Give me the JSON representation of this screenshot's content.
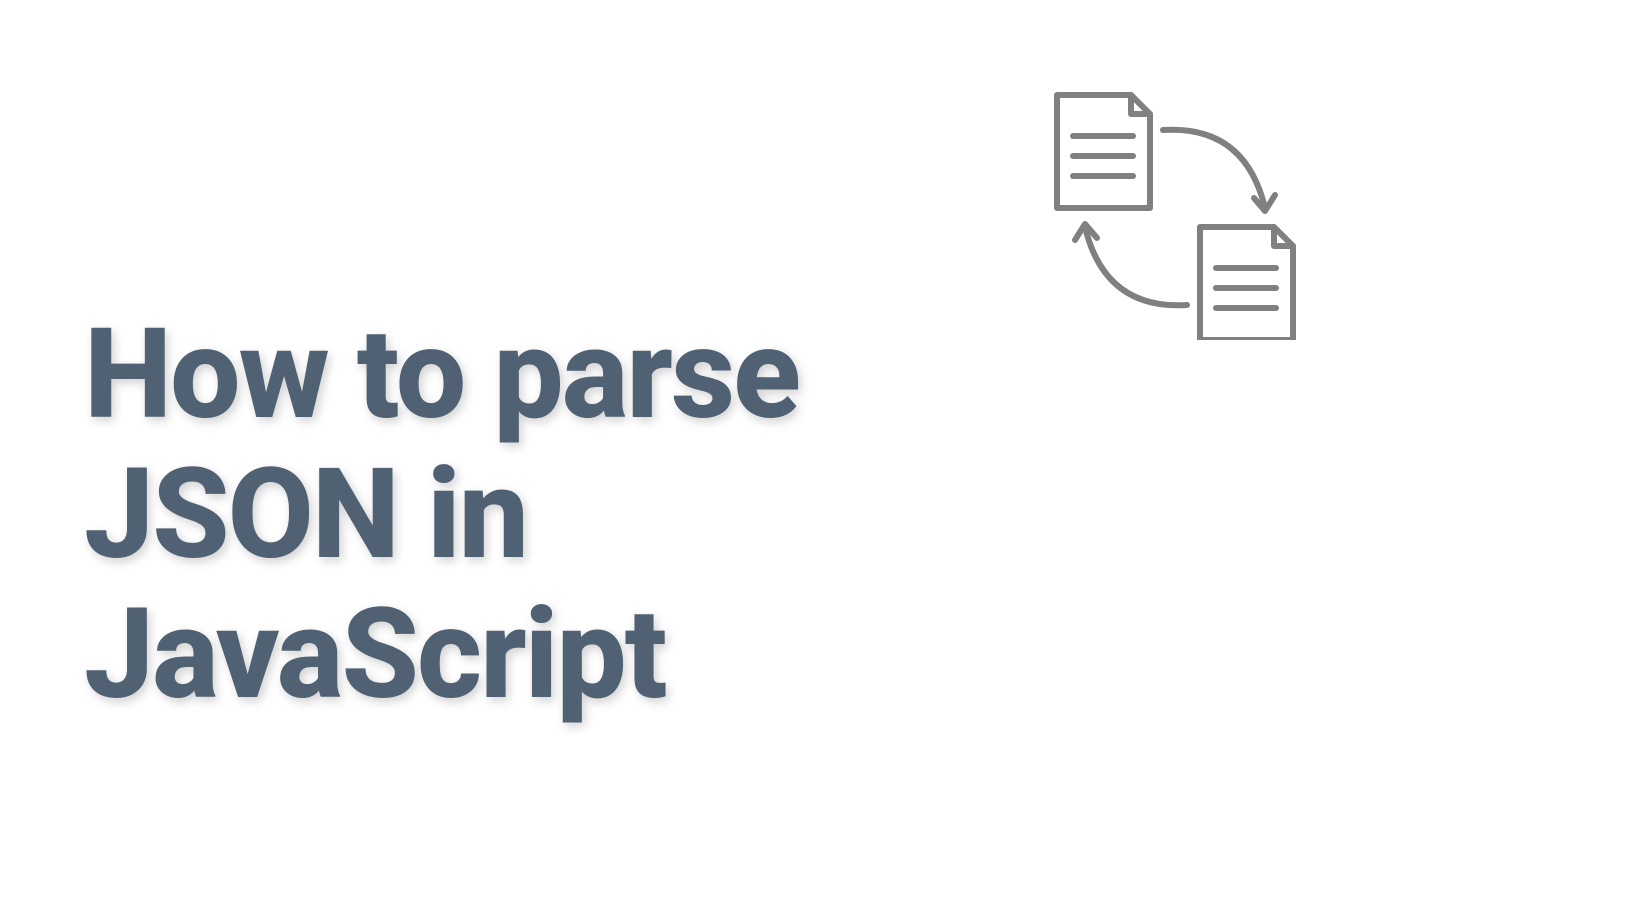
{
  "title": {
    "line1": "How to parse",
    "line2": "JSON in",
    "line3": "JavaScript"
  },
  "icon": {
    "name": "file-exchange-icon",
    "stroke_color": "#808080"
  }
}
